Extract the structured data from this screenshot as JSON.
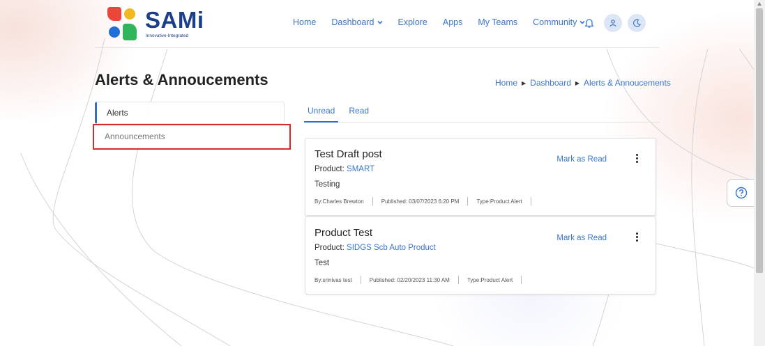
{
  "brand": {
    "name": "SAMi",
    "tagline": "Innovative-Integrated",
    "colors": {
      "red": "#e8473a",
      "yellow": "#f2b822",
      "blue": "#1f6fd6",
      "green": "#2fb65a",
      "text": "#1c3f8a"
    }
  },
  "nav": {
    "items": [
      {
        "label": "Home",
        "dropdown": false
      },
      {
        "label": "Dashboard",
        "dropdown": true
      },
      {
        "label": "Explore",
        "dropdown": false
      },
      {
        "label": "Apps",
        "dropdown": false
      },
      {
        "label": "My Teams",
        "dropdown": false
      },
      {
        "label": "Community",
        "dropdown": true
      }
    ],
    "icons": [
      "bell-icon",
      "user-icon",
      "moon-icon"
    ]
  },
  "page": {
    "title": "Alerts & Annoucements",
    "breadcrumb": [
      "Home",
      "Dashboard",
      "Alerts & Annoucements"
    ]
  },
  "menu": {
    "items": [
      {
        "label": "Alerts",
        "active": true
      },
      {
        "label": "Announcements",
        "active": false
      }
    ]
  },
  "tabs": [
    {
      "label": "Unread",
      "active": true
    },
    {
      "label": "Read",
      "active": false
    }
  ],
  "cards": [
    {
      "title": "Test Draft post",
      "product_label": "Product:",
      "product": "SMART",
      "description": "Testing",
      "by": "By:Charles Brewton",
      "published": "Published: 03/07/2023 6:20 PM",
      "type": "Type:Product Alert",
      "action": "Mark as Read"
    },
    {
      "title": "Product Test",
      "product_label": "Product:",
      "product": "SIDGS Scb Auto Product",
      "description": "Test",
      "by": "By:srinivas test",
      "published": "Published: 02/20/2023 11:30 AM",
      "type": "Type:Product Alert",
      "action": "Mark as Read"
    }
  ],
  "colors": {
    "accent": "#3b76c9",
    "highlight": "#d62b2b",
    "active_border": "#2d6fd0"
  }
}
